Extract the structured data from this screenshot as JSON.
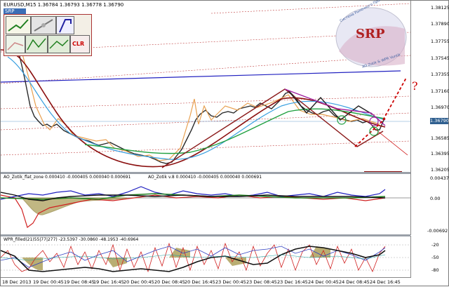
{
  "header": {
    "symbol_line": "EURUSD,M15  1.36784 1.36793 1.36778 1.36790",
    "srp_tab": "SRP"
  },
  "toolbox": {
    "clr_label": "CLR"
  },
  "watermark": {
    "logo_text": "SRP",
    "arc_text": "Система Рыночного Прогнозирования",
    "credit_text": "AO Zotik & WPR Vuntik"
  },
  "annotation": {
    "question": "?"
  },
  "price_axis": {
    "labels": [
      "1.38125",
      "1.37890",
      "1.37755",
      "1.37545",
      "1.37355",
      "1.37160",
      "1.36970",
      "1.36790",
      "1.36585",
      "1.36395",
      "1.36205"
    ],
    "current_price": "1.36790"
  },
  "ao_panel": {
    "title_left": "AO_Zotik_flat_zone 0.000410 -0.000405 0.000040 0.000691",
    "title_right": "AO_Zotik v.8 0.000410 -0.000405 0.000040 0.000691",
    "axis_labels": [
      "0.00437",
      "0.00",
      "-0.00692"
    ]
  },
  "wpr_panel": {
    "title": "WPR_filled(21)55|77|277) -23.5397 -30.0860 -48.1953 -40.6964",
    "axis_labels": [
      "-20",
      "-50",
      "-80"
    ]
  },
  "time_axis": {
    "labels": [
      "18 Dec 2013",
      "19 Dec 00:45",
      "19 Dec 08:45",
      "19 Dec 16:45",
      "20 Dec 00:45",
      "20 Dec 08:45",
      "20 Dec 16:45",
      "23 Dec 00:45",
      "23 Dec 08:45",
      "23 Dec 16:45",
      "24 Dec 00:45",
      "24 Dec 08:45",
      "24 Dec 16:45"
    ]
  },
  "colors": {
    "candles": "#2a2a2a",
    "bull_trend": "#e8a050",
    "ma_red": "#8b1010",
    "ma_blue": "#3aa0e0",
    "ma_green": "#20a040",
    "blue_line": "#2020c0",
    "pattern": "#8b1a1a",
    "wpr_fill": "#a89a50"
  }
}
